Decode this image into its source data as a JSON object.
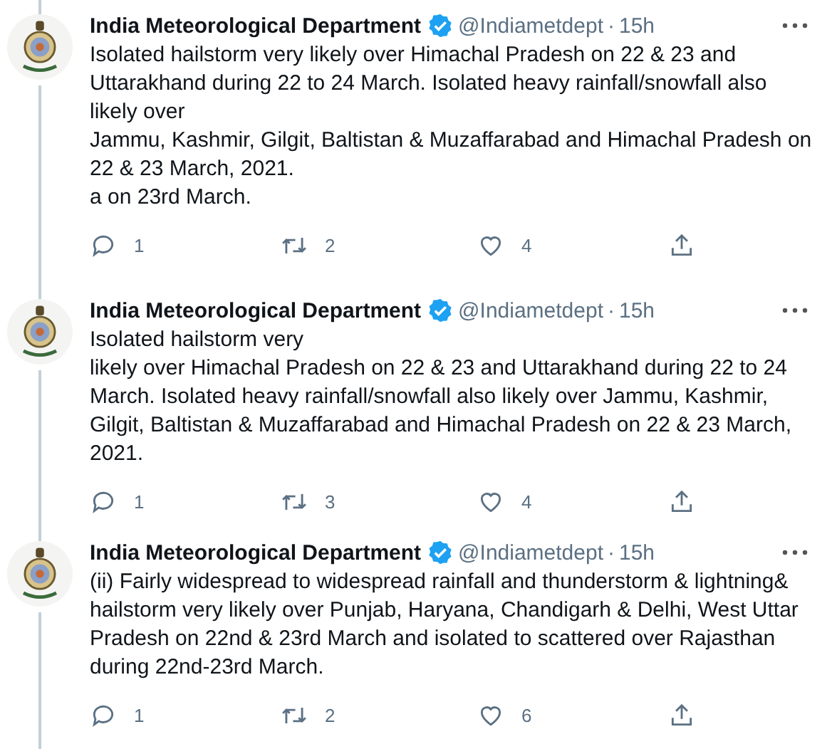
{
  "tweets": [
    {
      "name": "India Meteorological Department",
      "verified": true,
      "handle": "@Indiametdept",
      "separator": "·",
      "time": "15h",
      "lines": [
        "Isolated hailstorm very likely over Himachal Pradesh on 22 & 23 and",
        "Uttarakhand during 22 to 24 March. Isolated heavy rainfall/snowfall also",
        "likely over",
        "Jammu, Kashmir, Gilgit, Baltistan & Muzaffarabad and Himachal Pradesh on",
        "22 & 23 March, 2021.",
        "a on 23rd March."
      ],
      "replies": "1",
      "retweets": "2",
      "likes": "4"
    },
    {
      "name": "India Meteorological Department",
      "verified": true,
      "handle": "@Indiametdept",
      "separator": "·",
      "time": "15h",
      "lines": [
        "Isolated hailstorm very",
        "likely over Himachal Pradesh on 22 & 23 and Uttarakhand during 22 to 24",
        "March. Isolated heavy rainfall/snowfall also likely over Jammu, Kashmir,",
        "Gilgit, Baltistan & Muzaffarabad and Himachal Pradesh on 22 & 23 March,",
        "2021."
      ],
      "replies": "1",
      "retweets": "3",
      "likes": "4"
    },
    {
      "name": "India Meteorological Department",
      "verified": true,
      "handle": "@Indiametdept",
      "separator": "·",
      "time": "15h",
      "lines": [
        "(ii) Fairly widespread to widespread rainfall and thunderstorm & lightning&",
        "hailstorm very likely over Punjab, Haryana, Chandigarh & Delhi, West Uttar",
        "Pradesh on 22nd & 23rd March and isolated to scattered over Rajasthan",
        "during 22nd-23rd March."
      ],
      "replies": "1",
      "retweets": "2",
      "likes": "6"
    }
  ]
}
